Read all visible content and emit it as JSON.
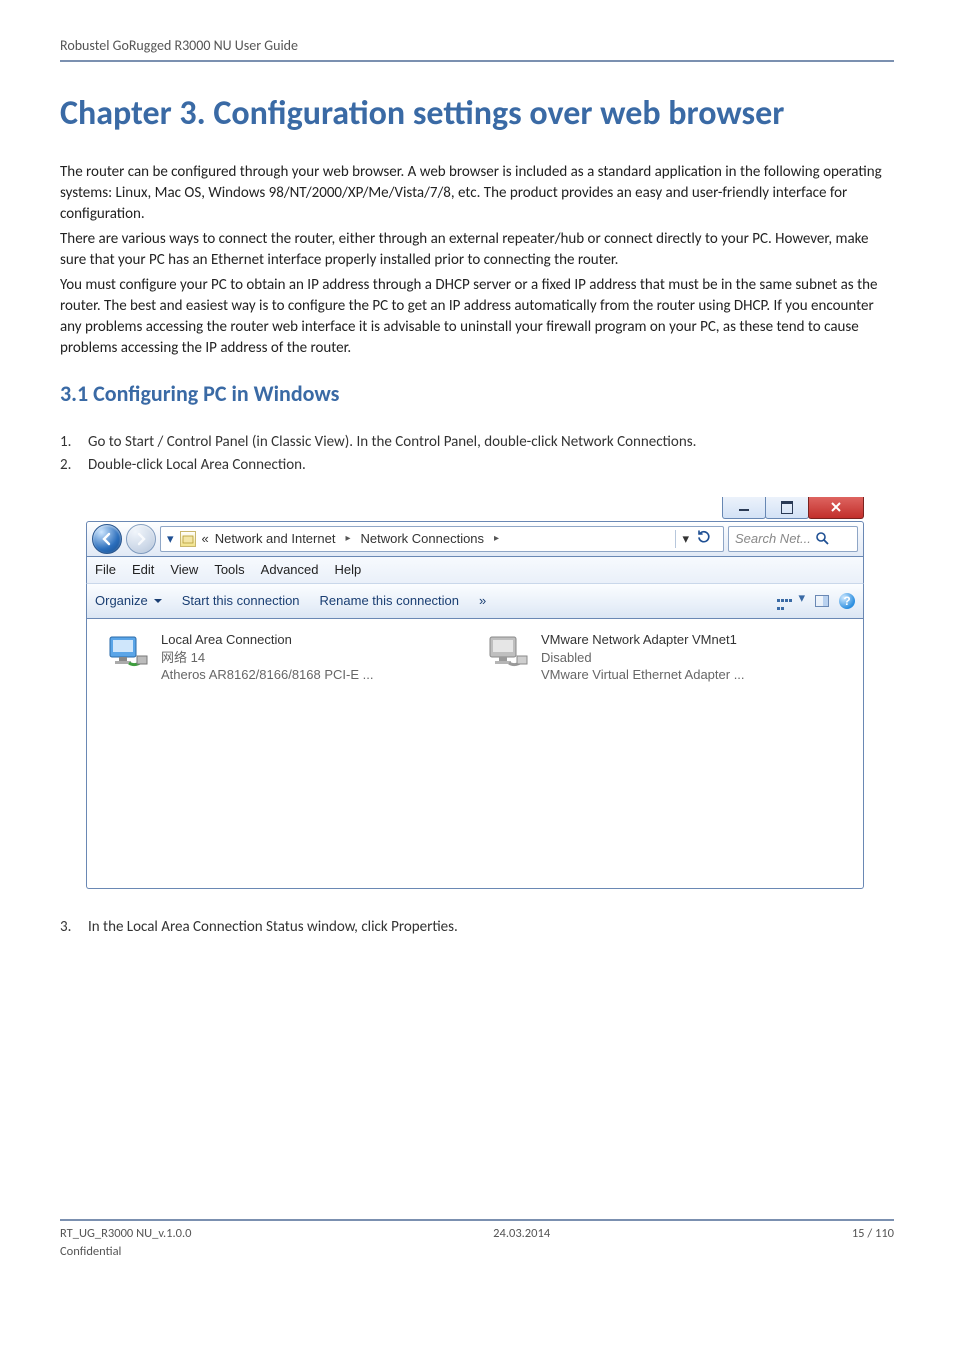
{
  "header": {
    "text": "Robustel GoRugged R3000 NU User Guide"
  },
  "chapter": {
    "title": "Chapter 3.  Configuration settings over web browser"
  },
  "intro": {
    "p1": "The router can be configured through your web browser. A web browser is included as a standard application in the following operating systems: Linux, Mac OS, Windows 98/NT/2000/XP/Me/Vista/7/8, etc. The product provides an easy and user-friendly interface for configuration.",
    "p2": "There are various ways to connect the router, either through an external repeater/hub or connect directly to your PC. However, make sure that your PC has an Ethernet interface properly installed prior to connecting the router.",
    "p3": "You must configure your PC to obtain an IP address through a DHCP server or a fixed IP address that must be in the same subnet as the router. The best and easiest way is to configure the PC to get an IP address automatically from the router using DHCP. If you encounter any problems accessing the router web interface it is advisable to uninstall your firewall program on your PC, as these tend to cause problems accessing the IP address of the router."
  },
  "section31": {
    "title": "3.1    Configuring PC in Windows"
  },
  "steps": {
    "s1_num": "1.",
    "s1": "Go to Start / Control Panel (in Classic View). In the Control Panel, double-click Network Connections.",
    "s2_num": "2.",
    "s2": "Double-click Local Area Connection.",
    "s3_num": "3.",
    "s3": "In the Local Area Connection Status window, click Properties."
  },
  "win": {
    "breadcrumb": {
      "laquo": "«",
      "seg1": "Network and Internet",
      "arrow": "▸",
      "seg2": "Network Connections",
      "arrow2": "▸"
    },
    "search_placeholder": "Search Net...",
    "menus": {
      "file": "File",
      "edit": "Edit",
      "view": "View",
      "tools": "Tools",
      "advanced": "Advanced",
      "help": "Help"
    },
    "toolbar": {
      "organize": "Organize",
      "start": "Start this connection",
      "rename": "Rename this connection",
      "more": "»",
      "help": "?"
    },
    "conn_left": {
      "title": "Local Area Connection",
      "sub1": "网络 14",
      "sub2": "Atheros AR8162/8166/8168 PCI-E ..."
    },
    "conn_right": {
      "title": "VMware Network Adapter VMnet1",
      "sub1": "Disabled",
      "sub2": "VMware Virtual Ethernet Adapter ..."
    }
  },
  "footer": {
    "left": "RT_UG_R3000 NU_v.1.0.0",
    "center": "24.03.2014",
    "right": "15 / 110",
    "conf": "Confidential"
  }
}
